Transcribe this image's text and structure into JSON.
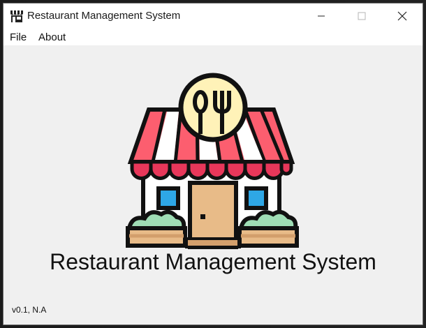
{
  "window": {
    "title": "Restaurant Management System",
    "icon": "restaurant-store-icon"
  },
  "menu": {
    "items": [
      {
        "label": "File"
      },
      {
        "label": "About"
      }
    ]
  },
  "main": {
    "logo_icon": "restaurant-store-logo",
    "app_name": "Restaurant Management System",
    "version_info": "v0.1, N.A"
  },
  "colors": {
    "awning_red": "#fc5e6f",
    "awning_stripe_white": "#ffffff",
    "awning_scallop": "#e8375a",
    "badge_yellow": "#fff2b8",
    "door_tan": "#e8bb88",
    "window_blue": "#2ea7e6",
    "bush_green": "#9fddb5",
    "planter_tan": "#e8bb88",
    "outline": "#111111"
  }
}
